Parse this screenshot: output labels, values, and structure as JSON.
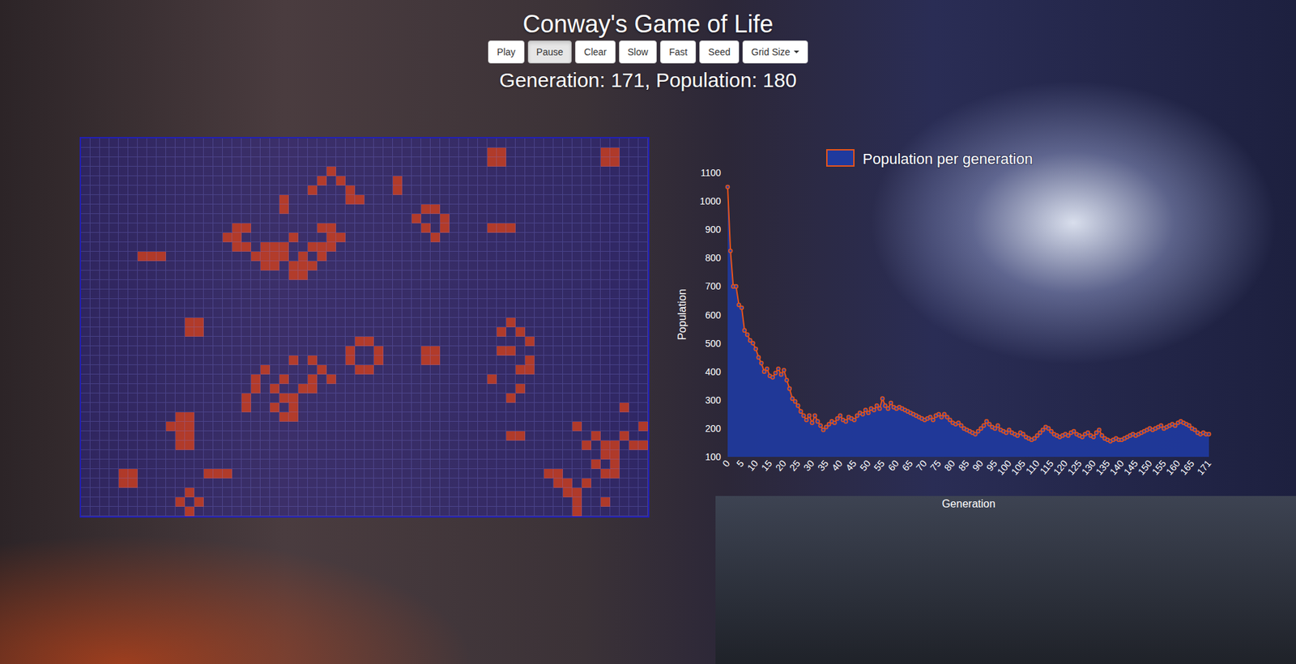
{
  "title": "Conway's Game of Life",
  "controls": [
    {
      "label": "Play",
      "kind": "button",
      "selected": false
    },
    {
      "label": "Pause",
      "kind": "button",
      "selected": true
    },
    {
      "label": "Clear",
      "kind": "button",
      "selected": false
    },
    {
      "label": "Slow",
      "kind": "button",
      "selected": false
    },
    {
      "label": "Fast",
      "kind": "button",
      "selected": false
    },
    {
      "label": "Seed",
      "kind": "button",
      "selected": false
    },
    {
      "label": "Grid Size",
      "kind": "dropdown",
      "selected": false
    }
  ],
  "stats": "Generation: 171, Population: 180",
  "grid": {
    "cols": 60,
    "rows": 40,
    "live": [
      [],
      [
        43,
        44,
        55,
        56
      ],
      [
        43,
        44,
        55,
        56
      ],
      [
        26
      ],
      [
        25,
        27,
        33
      ],
      [
        24,
        28,
        33
      ],
      [
        21,
        28,
        29
      ],
      [
        21,
        36,
        37
      ],
      [
        35,
        38
      ],
      [
        16,
        17,
        25,
        26,
        36,
        38,
        43,
        44,
        45
      ],
      [
        15,
        16,
        22,
        26,
        27,
        37
      ],
      [
        16,
        17,
        19,
        20,
        21,
        24,
        25,
        26
      ],
      [
        6,
        7,
        8,
        18,
        19,
        20,
        21,
        23,
        25
      ],
      [
        19,
        20,
        22,
        23,
        24
      ],
      [
        22,
        23
      ],
      [],
      [],
      [],
      [],
      [
        11,
        12,
        45
      ],
      [
        11,
        12,
        44,
        46
      ],
      [
        29,
        30,
        47
      ],
      [
        28,
        31,
        36,
        37,
        44,
        45
      ],
      [
        22,
        24,
        28,
        31,
        36,
        37,
        47
      ],
      [
        19,
        25,
        29,
        30,
        46,
        47
      ],
      [
        18,
        21,
        24,
        26,
        43
      ],
      [
        18,
        20,
        23,
        24,
        46
      ],
      [
        17,
        21,
        22,
        45
      ],
      [
        17,
        20,
        22,
        57
      ],
      [
        10,
        11,
        21,
        22
      ],
      [
        9,
        10,
        11,
        52,
        59
      ],
      [
        10,
        11,
        45,
        46,
        54,
        57
      ],
      [
        10,
        11,
        53,
        55,
        56,
        58,
        59
      ],
      [
        55,
        56
      ],
      [
        54,
        56
      ],
      [
        4,
        5,
        13,
        14,
        15,
        49,
        50,
        55,
        56
      ],
      [
        4,
        5,
        50,
        51,
        53
      ],
      [
        11,
        51,
        52
      ],
      [
        10,
        12,
        52,
        55
      ],
      [
        11,
        52
      ]
    ]
  },
  "chart": {
    "legend": "Population per generation",
    "y_axis_title": "Population",
    "x_axis_title": "Generation",
    "y_ticks": [
      "100",
      "200",
      "300",
      "400",
      "500",
      "600",
      "700",
      "800",
      "900",
      "1000",
      "1100"
    ],
    "x_ticks": [
      "0",
      "5",
      "10",
      "15",
      "20",
      "25",
      "30",
      "35",
      "40",
      "45",
      "50",
      "55",
      "60",
      "65",
      "70",
      "75",
      "80",
      "85",
      "90",
      "95",
      "100",
      "105",
      "110",
      "115",
      "120",
      "125",
      "130",
      "135",
      "140",
      "145",
      "150",
      "155",
      "160",
      "165",
      "171"
    ],
    "values": [
      1050,
      825,
      700,
      700,
      635,
      625,
      545,
      530,
      510,
      500,
      480,
      450,
      430,
      400,
      410,
      385,
      380,
      395,
      410,
      390,
      405,
      370,
      340,
      305,
      295,
      280,
      260,
      245,
      230,
      245,
      220,
      245,
      225,
      210,
      195,
      205,
      215,
      225,
      220,
      235,
      245,
      230,
      225,
      240,
      235,
      230,
      245,
      255,
      250,
      265,
      255,
      270,
      265,
      280,
      270,
      305,
      280,
      270,
      290,
      275,
      270,
      275,
      270,
      265,
      260,
      255,
      250,
      245,
      240,
      235,
      230,
      235,
      240,
      230,
      245,
      250,
      240,
      250,
      240,
      230,
      220,
      215,
      220,
      210,
      200,
      195,
      190,
      185,
      180,
      190,
      200,
      210,
      225,
      215,
      205,
      200,
      210,
      195,
      190,
      185,
      195,
      185,
      180,
      175,
      185,
      180,
      170,
      165,
      160,
      165,
      175,
      185,
      195,
      205,
      200,
      190,
      180,
      175,
      170,
      175,
      180,
      175,
      185,
      190,
      180,
      175,
      170,
      180,
      185,
      175,
      170,
      185,
      195,
      175,
      165,
      160,
      155,
      160,
      165,
      160,
      160,
      165,
      170,
      175,
      180,
      175,
      180,
      185,
      190,
      195,
      200,
      195,
      200,
      205,
      210,
      200,
      205,
      210,
      215,
      210,
      220,
      225,
      220,
      215,
      210,
      200,
      195,
      185,
      180,
      185,
      180,
      180
    ]
  }
}
